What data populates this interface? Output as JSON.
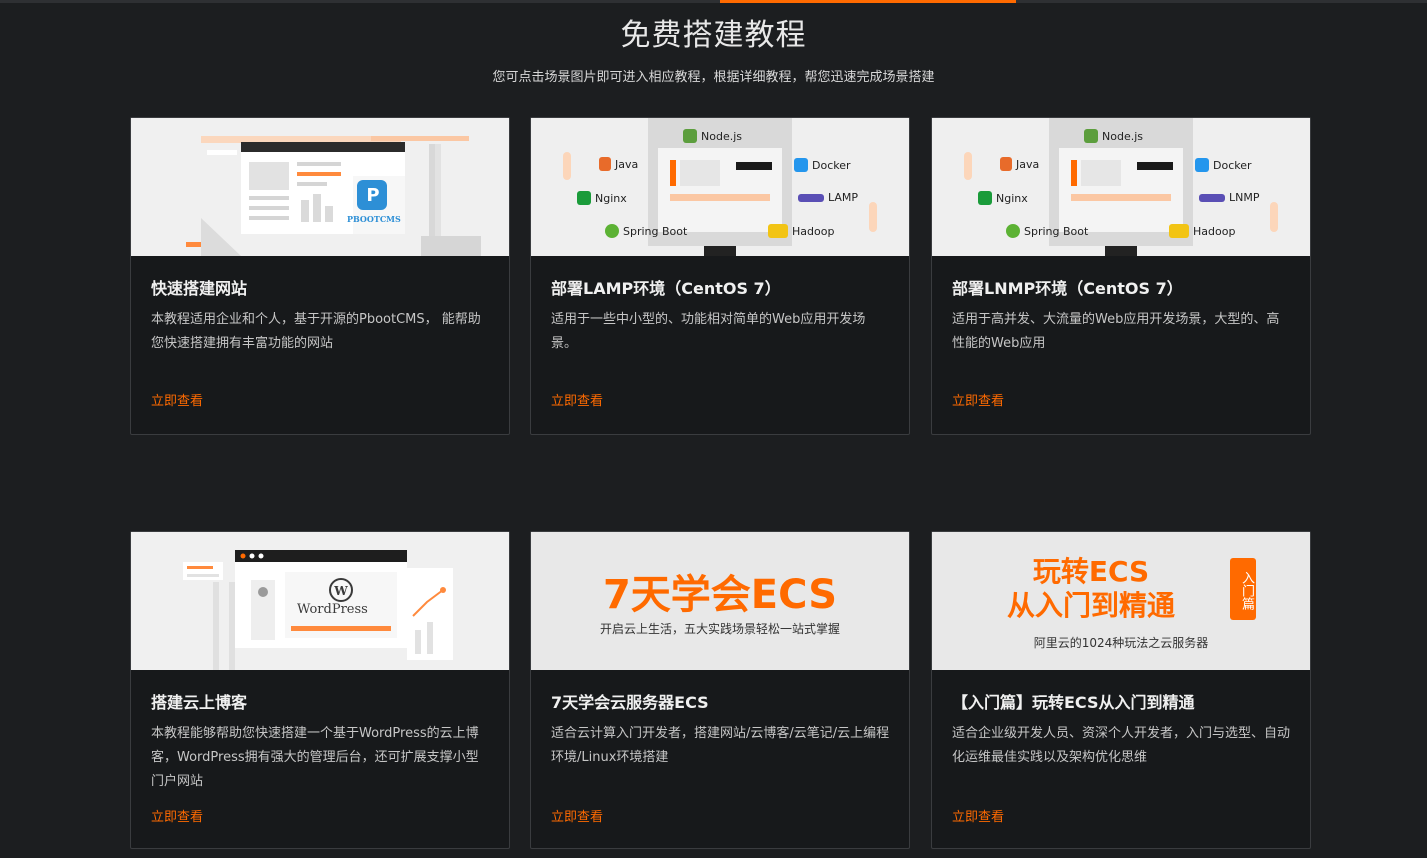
{
  "header": {
    "title": "免费搭建教程",
    "subtitle": "您可点击场景图片即可进入相应教程，根据详细教程，帮您迅速完成场景搭建"
  },
  "colors": {
    "accent": "#ff6a00",
    "background": "#1c1e20",
    "card": "#17191b"
  },
  "cards": [
    {
      "title": "快速搭建网站",
      "desc": "本教程适用企业和个人，基于开源的PbootCMS， 能帮助您快速搭建拥有丰富功能的网站",
      "link": "立即查看",
      "image": {
        "logo_text": "PBOOTCMS"
      }
    },
    {
      "title": "部署LAMP环境（CentOS 7）",
      "desc": "适用于一些中小型的、功能相对简单的Web应用开发场景。",
      "link": "立即查看",
      "image": {
        "labels": [
          "Node.js",
          "Java",
          "Nginx",
          "Spring Boot",
          "Docker",
          "LAMP",
          "Hadoop"
        ]
      }
    },
    {
      "title": "部署LNMP环境（CentOS 7）",
      "desc": "适用于高并发、大流量的Web应用开发场景，大型的、高性能的Web应用",
      "link": "立即查看",
      "image": {
        "labels": [
          "Node.js",
          "Java",
          "Nginx",
          "Spring Boot",
          "Docker",
          "LNMP",
          "Hadoop"
        ]
      }
    },
    {
      "title": "搭建云上博客",
      "desc": "本教程能够帮助您快速搭建一个基于WordPress的云上博客，WordPress拥有强大的管理后台，还可扩展支撑小型门户网站",
      "link": "立即查看",
      "image": {
        "logo_text": "WordPress"
      }
    },
    {
      "title": "7天学会云服务器ECS",
      "desc": "适合云计算入门开发者，搭建网站/云博客/云笔记/云上编程环境/Linux环境搭建",
      "link": "立即查看",
      "image": {
        "headline": "7天学会ECS",
        "tagline": "开启云上生活，五大实践场景轻松一站式掌握"
      }
    },
    {
      "title": "【入门篇】玩转ECS从入门到精通",
      "desc": "适合企业级开发人员、资深个人开发者，入门与选型、自动化运维最佳实践以及架构优化思维",
      "link": "立即查看",
      "image": {
        "headline1": "玩转ECS",
        "headline2": "从入门到精通",
        "badge": "入门篇",
        "tagline": "阿里云的1024种玩法之云服务器"
      }
    }
  ]
}
